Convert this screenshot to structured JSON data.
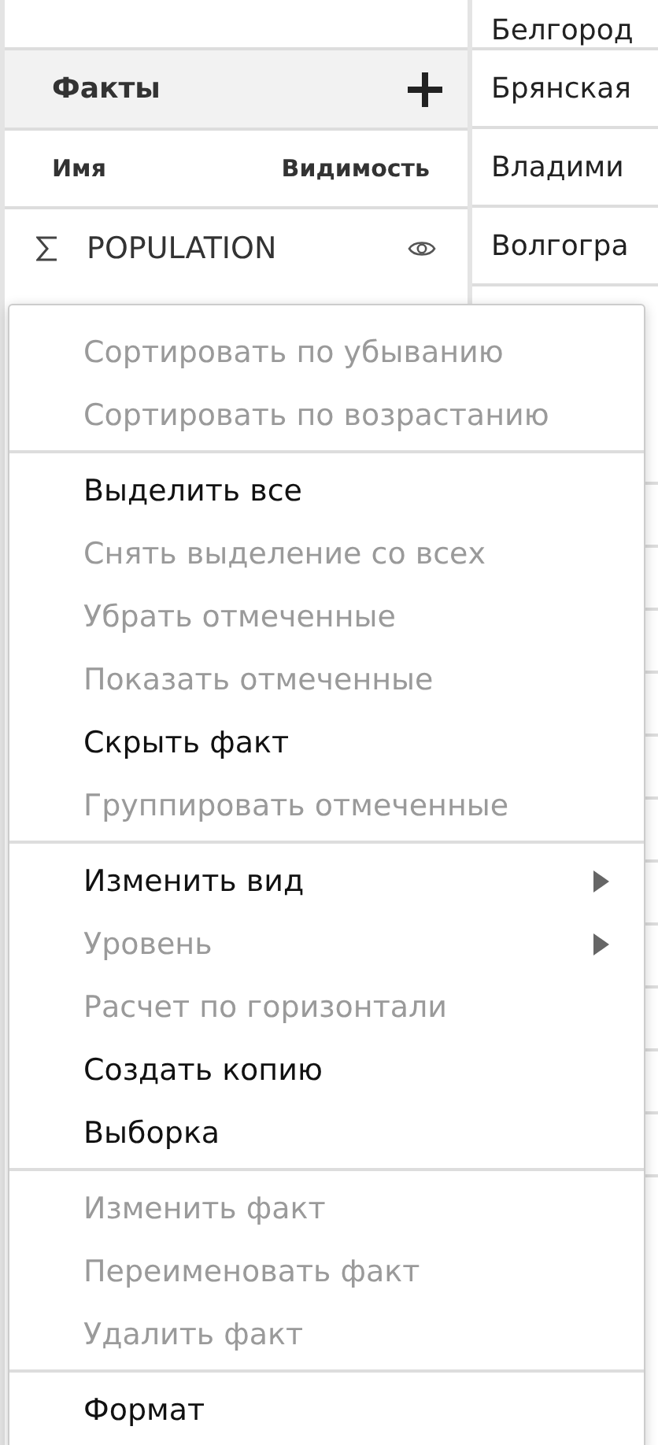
{
  "facts_panel": {
    "title": "Факты",
    "columns": [
      "Имя",
      "Видимость"
    ],
    "facts": [
      {
        "name": "POPULATION",
        "visible": true
      }
    ]
  },
  "table": {
    "cells": [
      "Белгород",
      "Брянская",
      "Владими",
      "Волгогра"
    ]
  },
  "context_menu": {
    "groups": [
      {
        "items": [
          {
            "label": "Сортировать по убыванию",
            "disabled": true,
            "submenu": false
          },
          {
            "label": "Сортировать по возрастанию",
            "disabled": true,
            "submenu": false
          }
        ]
      },
      {
        "items": [
          {
            "label": "Выделить все",
            "disabled": false,
            "submenu": false
          },
          {
            "label": "Снять выделение со всех",
            "disabled": true,
            "submenu": false
          },
          {
            "label": "Убрать отмеченные",
            "disabled": true,
            "submenu": false
          },
          {
            "label": "Показать отмеченные",
            "disabled": true,
            "submenu": false
          },
          {
            "label": "Скрыть факт",
            "disabled": false,
            "submenu": false
          },
          {
            "label": "Группировать отмеченные",
            "disabled": true,
            "submenu": false
          }
        ]
      },
      {
        "items": [
          {
            "label": "Изменить вид",
            "disabled": false,
            "submenu": true
          },
          {
            "label": "Уровень",
            "disabled": true,
            "submenu": true
          },
          {
            "label": "Расчет по горизонтали",
            "disabled": true,
            "submenu": false
          },
          {
            "label": "Создать копию",
            "disabled": false,
            "submenu": false
          },
          {
            "label": "Выборка",
            "disabled": false,
            "submenu": false
          }
        ]
      },
      {
        "items": [
          {
            "label": "Изменить факт",
            "disabled": true,
            "submenu": false
          },
          {
            "label": "Переименовать факт",
            "disabled": true,
            "submenu": false
          },
          {
            "label": "Удалить факт",
            "disabled": true,
            "submenu": false
          }
        ]
      },
      {
        "items": [
          {
            "label": "Формат",
            "disabled": false,
            "submenu": false
          }
        ]
      }
    ]
  }
}
